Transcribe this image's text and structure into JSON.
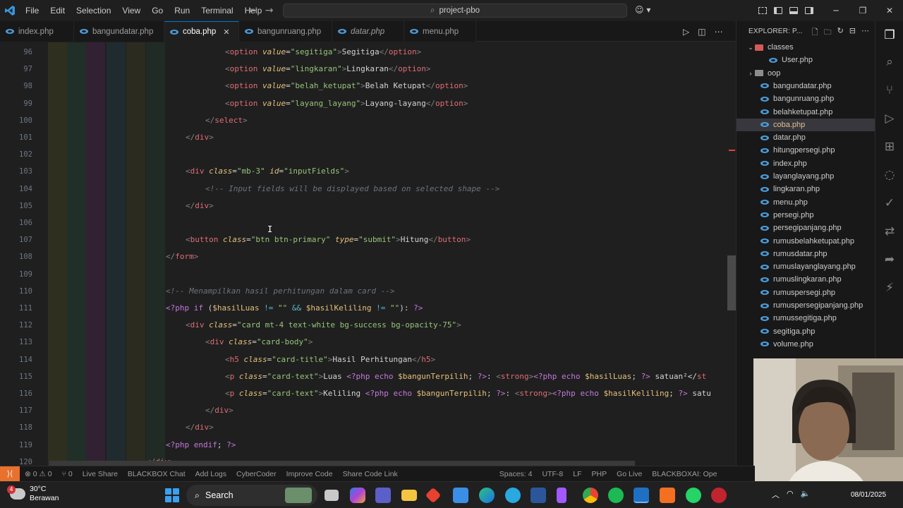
{
  "titlebar": {
    "menu": [
      "File",
      "Edit",
      "Selection",
      "View",
      "Go",
      "Run",
      "Terminal",
      "Help"
    ],
    "search": "project-pbo"
  },
  "tabs": [
    {
      "label": "index.php",
      "active": false,
      "italic": false
    },
    {
      "label": "bangundatar.php",
      "active": false,
      "italic": false
    },
    {
      "label": "coba.php",
      "active": true,
      "italic": false
    },
    {
      "label": "bangunruang.php",
      "active": false,
      "italic": false
    },
    {
      "label": "datar.php",
      "active": false,
      "italic": true
    },
    {
      "label": "menu.php",
      "active": false,
      "italic": false
    }
  ],
  "editor": {
    "line_numbers": [
      "96",
      "97",
      "98",
      "99",
      "100",
      "101",
      "102",
      "103",
      "104",
      "105",
      "106",
      "107",
      "108",
      "109",
      "110",
      "111",
      "112",
      "113",
      "114",
      "115",
      "116",
      "117",
      "118",
      "119",
      "120"
    ],
    "lines": [
      {
        "n": 0,
        "parts": [
          [
            "tag2",
            "<"
          ],
          [
            "tag",
            "option "
          ],
          [
            "attr",
            "value"
          ],
          [
            "wht",
            "="
          ],
          [
            "str",
            "\"segitiga\""
          ],
          [
            "tag2",
            ">"
          ],
          [
            "wht",
            "Segitiga"
          ],
          [
            "tag2",
            "</"
          ],
          [
            "tag",
            "option"
          ],
          [
            "tag2",
            ">"
          ]
        ]
      },
      {
        "n": 1,
        "parts": [
          [
            "tag2",
            "<"
          ],
          [
            "tag",
            "option "
          ],
          [
            "attr",
            "value"
          ],
          [
            "wht",
            "="
          ],
          [
            "str",
            "\"lingkaran\""
          ],
          [
            "tag2",
            ">"
          ],
          [
            "wht",
            "Lingkaran"
          ],
          [
            "tag2",
            "</"
          ],
          [
            "tag",
            "option"
          ],
          [
            "tag2",
            ">"
          ]
        ]
      },
      {
        "n": 2,
        "parts": [
          [
            "tag2",
            "<"
          ],
          [
            "tag",
            "option "
          ],
          [
            "attr",
            "value"
          ],
          [
            "wht",
            "="
          ],
          [
            "str",
            "\"belah_ketupat\""
          ],
          [
            "tag2",
            ">"
          ],
          [
            "wht",
            "Belah Ketupat"
          ],
          [
            "tag2",
            "</"
          ],
          [
            "tag",
            "option"
          ],
          [
            "tag2",
            ">"
          ]
        ]
      },
      {
        "n": 3,
        "parts": [
          [
            "tag2",
            "<"
          ],
          [
            "tag",
            "option "
          ],
          [
            "attr",
            "value"
          ],
          [
            "wht",
            "="
          ],
          [
            "str",
            "\"layang_layang\""
          ],
          [
            "tag2",
            ">"
          ],
          [
            "wht",
            "Layang-layang"
          ],
          [
            "tag2",
            "</"
          ],
          [
            "tag",
            "option"
          ],
          [
            "tag2",
            ">"
          ]
        ]
      },
      {
        "n": 4,
        "parts": [
          [
            "tag2",
            "</"
          ],
          [
            "tag",
            "select"
          ],
          [
            "tag2",
            ">"
          ]
        ]
      },
      {
        "n": 5,
        "parts": [
          [
            "tag2",
            "</"
          ],
          [
            "tag",
            "div"
          ],
          [
            "tag2",
            ">"
          ]
        ]
      },
      {
        "n": 6,
        "parts": []
      },
      {
        "n": 7,
        "parts": [
          [
            "tag2",
            "<"
          ],
          [
            "tag",
            "div "
          ],
          [
            "attr",
            "class"
          ],
          [
            "wht",
            "="
          ],
          [
            "str",
            "\"mb-3\" "
          ],
          [
            "attr",
            "id"
          ],
          [
            "wht",
            "="
          ],
          [
            "str",
            "\"inputFields\""
          ],
          [
            "tag2",
            ">"
          ]
        ]
      },
      {
        "n": 8,
        "parts": [
          [
            "cm",
            "<!-- Input fields will be displayed based on selected shape -->"
          ]
        ]
      },
      {
        "n": 9,
        "parts": [
          [
            "tag2",
            "</"
          ],
          [
            "tag",
            "div"
          ],
          [
            "tag2",
            ">"
          ]
        ]
      },
      {
        "n": 10,
        "parts": []
      },
      {
        "n": 11,
        "parts": [
          [
            "tag2",
            "<"
          ],
          [
            "tag",
            "button "
          ],
          [
            "attr",
            "class"
          ],
          [
            "wht",
            "="
          ],
          [
            "str",
            "\"btn btn-primary\" "
          ],
          [
            "attr",
            "type"
          ],
          [
            "wht",
            "="
          ],
          [
            "str",
            "\"submit\""
          ],
          [
            "tag2",
            ">"
          ],
          [
            "wht",
            "Hitung"
          ],
          [
            "tag2",
            "</"
          ],
          [
            "tag",
            "button"
          ],
          [
            "tag2",
            ">"
          ]
        ]
      },
      {
        "n": 12,
        "parts": [
          [
            "tag2",
            "</"
          ],
          [
            "tag",
            "form"
          ],
          [
            "tag2",
            ">"
          ]
        ]
      },
      {
        "n": 13,
        "parts": []
      },
      {
        "n": 14,
        "parts": [
          [
            "cm",
            "<!-- Menampilkan hasil perhitungan dalam card -->"
          ]
        ]
      },
      {
        "n": 15,
        "parts": [
          [
            "php",
            "<?php "
          ],
          [
            "php",
            "if "
          ],
          [
            "wht",
            "("
          ],
          [
            "var",
            "$hasilLuas "
          ],
          [
            "op",
            "!= "
          ],
          [
            "str",
            "\"\" "
          ],
          [
            "op",
            "&& "
          ],
          [
            "var",
            "$hasilKeliling "
          ],
          [
            "op",
            "!= "
          ],
          [
            "str",
            "\"\""
          ],
          [
            "wht",
            "): "
          ],
          [
            "php",
            "?>"
          ]
        ]
      },
      {
        "n": 16,
        "parts": [
          [
            "tag2",
            "<"
          ],
          [
            "tag",
            "div "
          ],
          [
            "attr",
            "class"
          ],
          [
            "wht",
            "="
          ],
          [
            "str",
            "\"card mt-4 text-white bg-success bg-opacity-75\""
          ],
          [
            "tag2",
            ">"
          ]
        ]
      },
      {
        "n": 17,
        "parts": [
          [
            "tag2",
            "<"
          ],
          [
            "tag",
            "div "
          ],
          [
            "attr",
            "class"
          ],
          [
            "wht",
            "="
          ],
          [
            "str",
            "\"card-body\""
          ],
          [
            "tag2",
            ">"
          ]
        ]
      },
      {
        "n": 18,
        "parts": [
          [
            "tag2",
            "<"
          ],
          [
            "tag",
            "h5 "
          ],
          [
            "attr",
            "class"
          ],
          [
            "wht",
            "="
          ],
          [
            "str",
            "\"card-title\""
          ],
          [
            "tag2",
            ">"
          ],
          [
            "wht",
            "Hasil Perhitungan"
          ],
          [
            "tag2",
            "</"
          ],
          [
            "tag",
            "h5"
          ],
          [
            "tag2",
            ">"
          ]
        ]
      },
      {
        "n": 19,
        "parts": [
          [
            "tag2",
            "<"
          ],
          [
            "tag",
            "p "
          ],
          [
            "attr",
            "class"
          ],
          [
            "wht",
            "="
          ],
          [
            "str",
            "\"card-text\""
          ],
          [
            "tag2",
            ">"
          ],
          [
            "wht",
            "Luas "
          ],
          [
            "php",
            "<?php "
          ],
          [
            "php",
            "echo "
          ],
          [
            "var",
            "$bangunTerpilih"
          ],
          [
            "wht",
            "; "
          ],
          [
            "php",
            "?>"
          ],
          [
            "wht",
            ": "
          ],
          [
            "tag2",
            "<"
          ],
          [
            "tag",
            "strong"
          ],
          [
            "tag2",
            ">"
          ],
          [
            "php",
            "<?php "
          ],
          [
            "php",
            "echo "
          ],
          [
            "var",
            "$hasilLuas"
          ],
          [
            "wht",
            "; "
          ],
          [
            "php",
            "?> "
          ],
          [
            "wht",
            "satuan²</"
          ],
          [
            "tag",
            "st"
          ]
        ]
      },
      {
        "n": 20,
        "parts": [
          [
            "tag2",
            "<"
          ],
          [
            "tag",
            "p "
          ],
          [
            "attr",
            "class"
          ],
          [
            "wht",
            "="
          ],
          [
            "str",
            "\"card-text\""
          ],
          [
            "tag2",
            ">"
          ],
          [
            "wht",
            "Keliling "
          ],
          [
            "php",
            "<?php "
          ],
          [
            "php",
            "echo "
          ],
          [
            "var",
            "$bangunTerpilih"
          ],
          [
            "wht",
            "; "
          ],
          [
            "php",
            "?>"
          ],
          [
            "wht",
            ": "
          ],
          [
            "tag2",
            "<"
          ],
          [
            "tag",
            "strong"
          ],
          [
            "tag2",
            ">"
          ],
          [
            "php",
            "<?php "
          ],
          [
            "php",
            "echo "
          ],
          [
            "var",
            "$hasilKeliling"
          ],
          [
            "wht",
            "; "
          ],
          [
            "php",
            "?> "
          ],
          [
            "wht",
            "satu"
          ]
        ]
      },
      {
        "n": 21,
        "parts": [
          [
            "tag2",
            "</"
          ],
          [
            "tag",
            "div"
          ],
          [
            "tag2",
            ">"
          ]
        ]
      },
      {
        "n": 22,
        "parts": [
          [
            "tag2",
            "</"
          ],
          [
            "tag",
            "div"
          ],
          [
            "tag2",
            ">"
          ]
        ]
      },
      {
        "n": 23,
        "parts": [
          [
            "php",
            "<?php "
          ],
          [
            "php",
            "endif"
          ],
          [
            "wht",
            "; "
          ],
          [
            "php",
            "?>"
          ]
        ]
      },
      {
        "n": 24,
        "parts": [
          [
            "tag2",
            "</"
          ],
          [
            "tag",
            "div"
          ],
          [
            "tag2",
            ">"
          ]
        ]
      }
    ]
  },
  "explorer": {
    "header": "EXPLORER: P...",
    "items": [
      {
        "label": "classes",
        "type": "folder",
        "open": true,
        "red": true,
        "depth": 1
      },
      {
        "label": "User.php",
        "type": "file",
        "depth": 2
      },
      {
        "label": "oop",
        "type": "folder",
        "open": false,
        "red": false,
        "depth": 1
      },
      {
        "label": "bangundatar.php",
        "type": "file",
        "depth": 1
      },
      {
        "label": "bangunruang.php",
        "type": "file",
        "depth": 1
      },
      {
        "label": "belahketupat.php",
        "type": "file",
        "depth": 1
      },
      {
        "label": "coba.php",
        "type": "file",
        "depth": 1,
        "selected": true
      },
      {
        "label": "datar.php",
        "type": "file",
        "depth": 1
      },
      {
        "label": "hitungpersegi.php",
        "type": "file",
        "depth": 1
      },
      {
        "label": "index.php",
        "type": "file",
        "depth": 1
      },
      {
        "label": "layanglayang.php",
        "type": "file",
        "depth": 1
      },
      {
        "label": "lingkaran.php",
        "type": "file",
        "depth": 1
      },
      {
        "label": "menu.php",
        "type": "file",
        "depth": 1
      },
      {
        "label": "persegi.php",
        "type": "file",
        "depth": 1
      },
      {
        "label": "persegipanjang.php",
        "type": "file",
        "depth": 1
      },
      {
        "label": "rumusbelahketupat.php",
        "type": "file",
        "depth": 1
      },
      {
        "label": "rumusdatar.php",
        "type": "file",
        "depth": 1
      },
      {
        "label": "rumuslayanglayang.php",
        "type": "file",
        "depth": 1
      },
      {
        "label": "rumuslingkaran.php",
        "type": "file",
        "depth": 1
      },
      {
        "label": "rumuspersegi.php",
        "type": "file",
        "depth": 1
      },
      {
        "label": "rumuspersegipanjang.php",
        "type": "file",
        "depth": 1
      },
      {
        "label": "rumussegitiga.php",
        "type": "file",
        "depth": 1
      },
      {
        "label": "segitiga.php",
        "type": "file",
        "depth": 1
      },
      {
        "label": "volume.php",
        "type": "file",
        "depth": 1
      }
    ]
  },
  "statusbar": {
    "problems": "⊗ 0 ⚠ 0",
    "ports": "⑂ 0",
    "live_share": "Live Share",
    "blackbox_chat": "BLACKBOX Chat",
    "add_logs": "Add Logs",
    "cybercoder": "CyberCoder",
    "improve_code": "Improve Code",
    "share_code_link": "Share Code Link",
    "spaces": "Spaces: 4",
    "encoding": "UTF-8",
    "eol": "LF",
    "language": "PHP",
    "go_live": "Go Live",
    "blackbox_ai": "BLACKBOXAI: Ope"
  },
  "taskbar": {
    "weather_temp": "30°C",
    "weather_desc": "Berawan",
    "weather_badge": "4",
    "search": "Search",
    "date": "08/01/2025"
  },
  "colors": {
    "accent": "#0078d4",
    "remote": "#e8712d",
    "selected_file": "#e2c08d"
  }
}
